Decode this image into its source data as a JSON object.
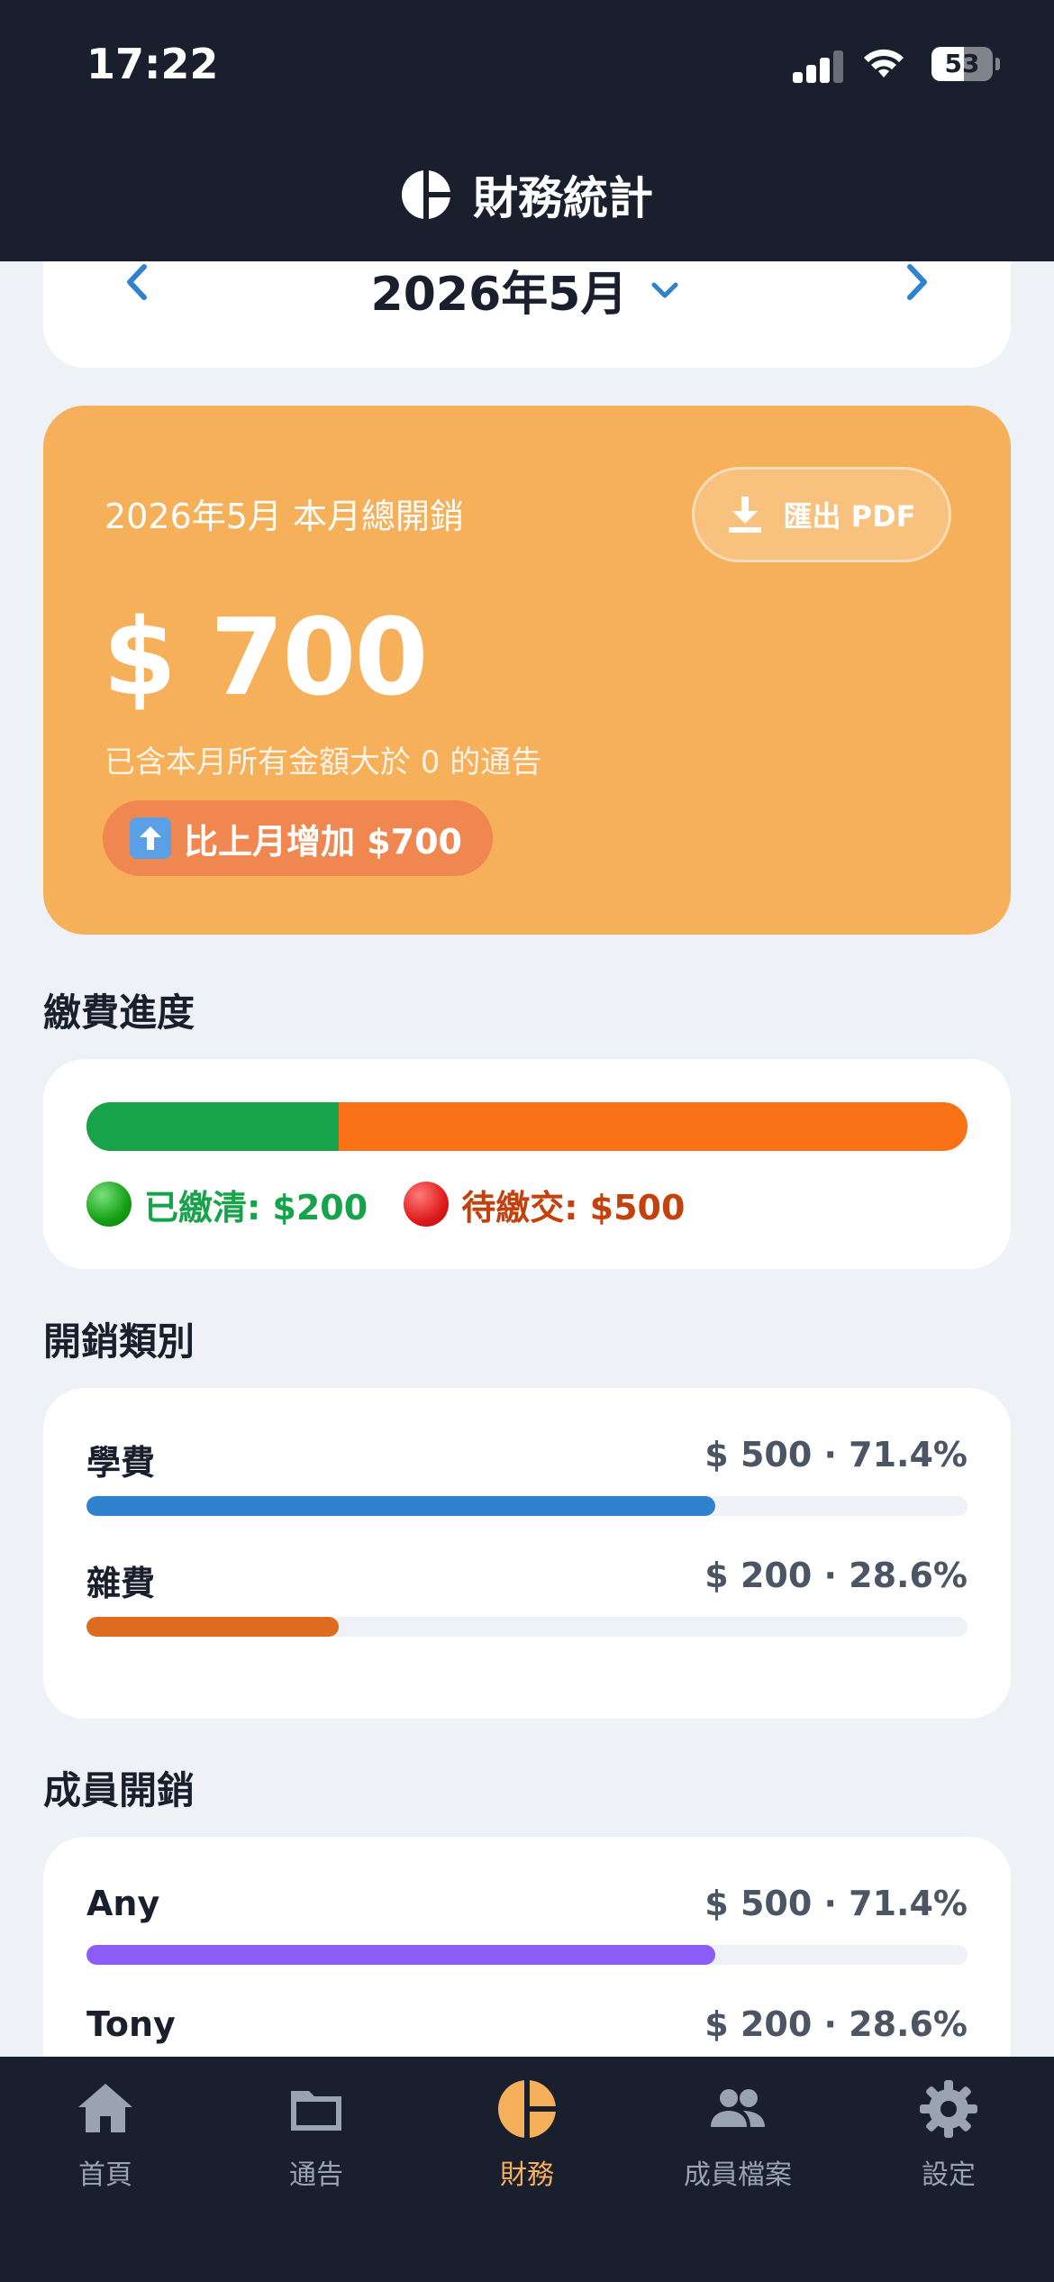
{
  "status_bar": {
    "time": "17:22",
    "battery": "53",
    "battery_level": 0.53
  },
  "header": {
    "title": "財務統計"
  },
  "month_selector": {
    "label": "2026年5月"
  },
  "summary": {
    "period_label": "2026年5月 本月總開銷",
    "export_label": "匯出 PDF",
    "amount": "$ 700",
    "note": "已含本月所有金額大於 0 的通告",
    "compare": "比上月增加 $700"
  },
  "payment_progress": {
    "title": "繳費進度",
    "paid_fraction": 0.286,
    "paid_label": "已繳清: $200",
    "due_label": "待繳交: $500"
  },
  "categories": {
    "title": "開銷類別",
    "items": [
      {
        "name": "學費",
        "value": "$ 500 · 71.4%",
        "fraction": 0.714,
        "color": "#3182ce"
      },
      {
        "name": "雜費",
        "value": "$ 200 · 28.6%",
        "fraction": 0.286,
        "color": "#dd6b20"
      }
    ]
  },
  "members": {
    "title": "成員開銷",
    "items": [
      {
        "name": "Any",
        "value": "$ 500 · 71.4%",
        "fraction": 0.714,
        "color": "#8b5cf6"
      },
      {
        "name": "Tony",
        "value": "$ 200 · 28.6%",
        "fraction": 0.286,
        "color": "#8b5cf6"
      }
    ]
  },
  "tabs": [
    {
      "label": "首頁",
      "icon": "home-icon"
    },
    {
      "label": "通告",
      "icon": "folder-icon"
    },
    {
      "label": "財務",
      "icon": "pie-chart-icon",
      "active": true
    },
    {
      "label": "成員檔案",
      "icon": "people-icon"
    },
    {
      "label": "設定",
      "icon": "gear-icon"
    }
  ],
  "colors": {
    "header_bg": "#1a1f2e",
    "summary_bg": "#f6b05a",
    "paid": "#16a34a",
    "due": "#f97316",
    "accent_blue": "#3182ce",
    "active_tab": "#f6b05a"
  }
}
